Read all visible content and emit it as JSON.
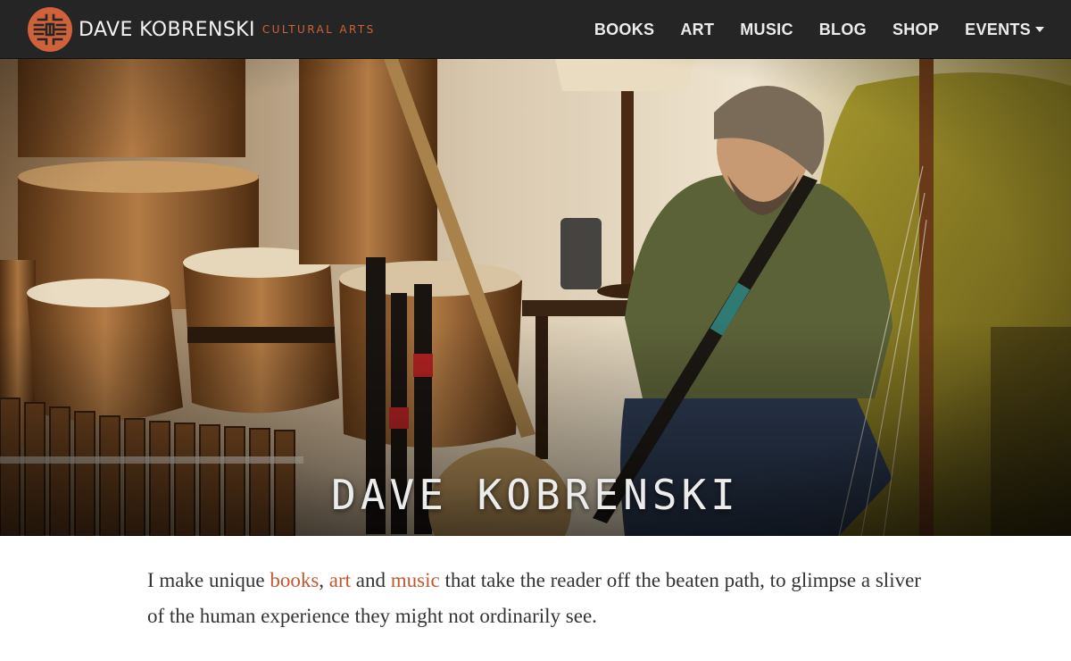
{
  "brand": {
    "name": "DAVE KOBRENSKI",
    "tagline": "CULTURAL ARTS"
  },
  "nav": {
    "items": [
      {
        "label": "BOOKS"
      },
      {
        "label": "ART"
      },
      {
        "label": "MUSIC"
      },
      {
        "label": "BLOG"
      },
      {
        "label": "SHOP"
      },
      {
        "label": "EVENTS"
      }
    ]
  },
  "hero": {
    "title": "DAVE KOBRENSKI"
  },
  "intro": {
    "part1": "I make unique ",
    "link_books": "books",
    "part2": ", ",
    "link_art": "art",
    "part3": " and ",
    "link_music": "music",
    "part4": " that take the reader off the beaten path, to glimpse a sliver of the human experience they might not ordinarily see."
  },
  "colors": {
    "accent": "#c0572f",
    "navbar": "#252525",
    "logo": "#d0613a"
  }
}
